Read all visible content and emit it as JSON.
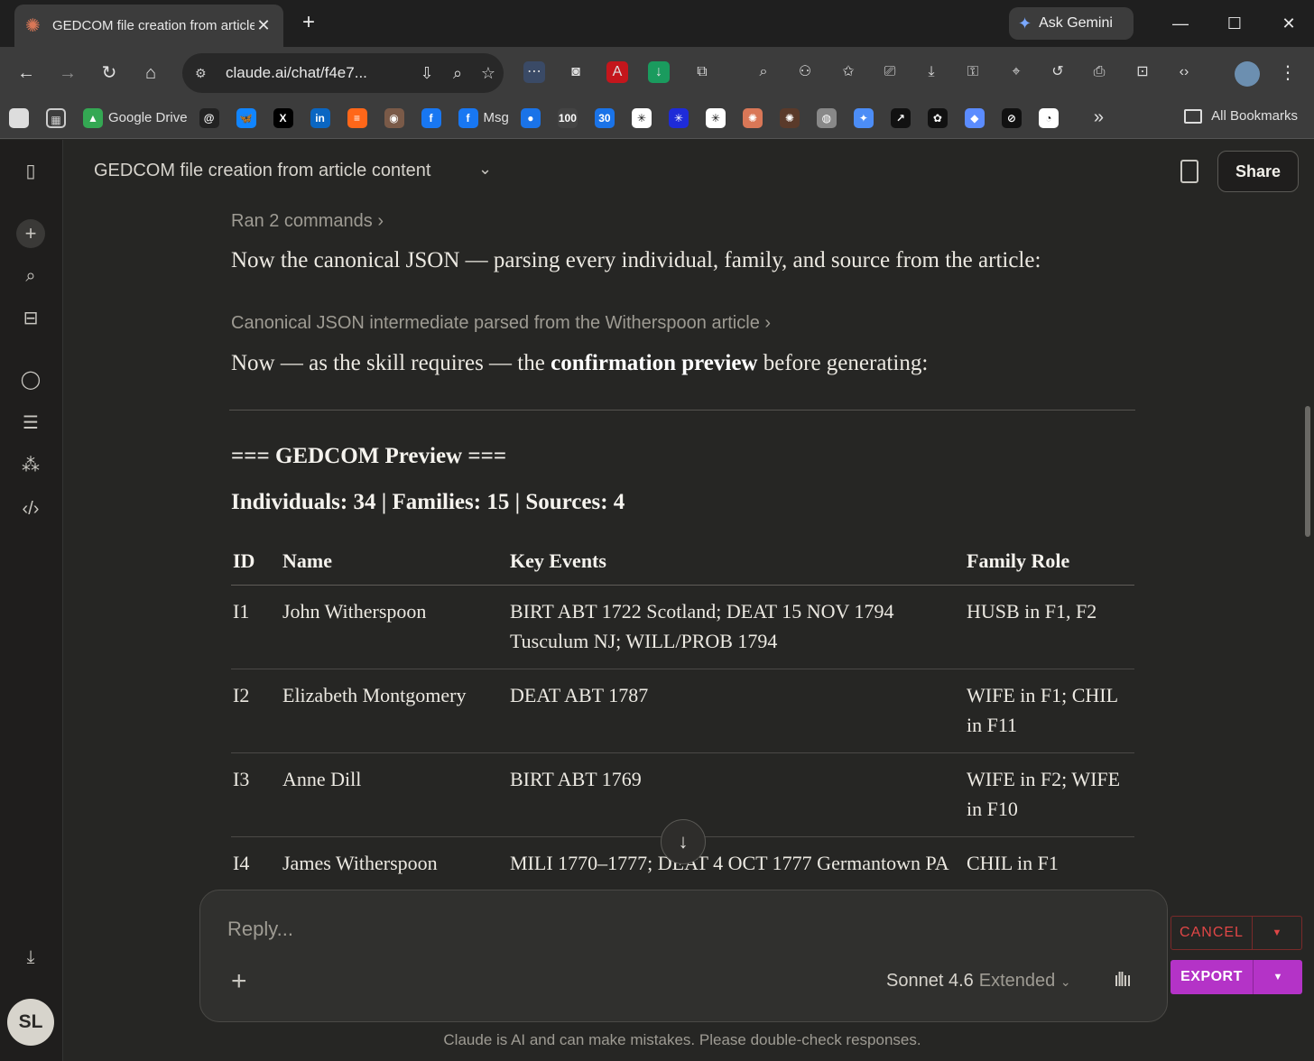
{
  "browser": {
    "tab_title": "GEDCOM file creation from article content",
    "ask_gemini": "Ask Gemini",
    "url": "claude.ai/chat/f4e7...",
    "bookmarks": [
      {
        "label": "Google Drive",
        "color": "#34a853",
        "glyph": "▲"
      },
      {
        "label": "",
        "color": "#222222",
        "glyph": "@"
      },
      {
        "label": "",
        "color": "#1185fe",
        "glyph": "🦋"
      },
      {
        "label": "",
        "color": "#000000",
        "glyph": "X"
      },
      {
        "label": "",
        "color": "#0a66c2",
        "glyph": "in"
      },
      {
        "label": "",
        "color": "#ff6719",
        "glyph": "≡"
      },
      {
        "label": "",
        "color": "#7a5a48",
        "glyph": "◉"
      },
      {
        "label": "",
        "color": "#1877f2",
        "glyph": "f"
      },
      {
        "label": "Msg",
        "color": "#1877f2",
        "glyph": "f"
      },
      {
        "label": "",
        "color": "#1a73e8",
        "glyph": "●"
      },
      {
        "label": "",
        "color": "#444444",
        "glyph": "100"
      },
      {
        "label": "",
        "color": "#1a73e8",
        "glyph": "30"
      },
      {
        "label": "",
        "color": "#ffffff",
        "glyph": "✳"
      },
      {
        "label": "",
        "color": "#1e2bd8",
        "glyph": "✳"
      },
      {
        "label": "",
        "color": "#ffffff",
        "glyph": "✳"
      },
      {
        "label": "",
        "color": "#d97757",
        "glyph": "✺"
      },
      {
        "label": "",
        "color": "#5a3a2a",
        "glyph": "✺"
      },
      {
        "label": "",
        "color": "#888888",
        "glyph": "◍"
      },
      {
        "label": "",
        "color": "#4c8df6",
        "glyph": "✦"
      },
      {
        "label": "",
        "color": "#111111",
        "glyph": "↗"
      },
      {
        "label": "",
        "color": "#111111",
        "glyph": "✿"
      },
      {
        "label": "",
        "color": "#5b8cff",
        "glyph": "◆"
      },
      {
        "label": "",
        "color": "#111111",
        "glyph": "⊘"
      },
      {
        "label": "",
        "color": "#ffffff",
        "glyph": "◔"
      }
    ],
    "all_bookmarks": "All Bookmarks"
  },
  "app": {
    "chat_title": "GEDCOM file creation from article content",
    "share_label": "Share",
    "user_initials": "SL"
  },
  "message": {
    "ran_commands": "Ran 2 commands",
    "line1": "Now the canonical JSON — parsing every individual, family, and source from the article:",
    "artifact_label": "Canonical JSON intermediate parsed from the Witherspoon article",
    "line2_pre": "Now — as the skill requires — the ",
    "line2_bold": "confirmation preview",
    "line2_post": " before generating:",
    "preview_heading": "=== GEDCOM Preview ===",
    "preview_summary": "Individuals: 34 | Families: 15 | Sources: 4"
  },
  "table": {
    "headers": [
      "ID",
      "Name",
      "Key Events",
      "Family Role"
    ],
    "rows": [
      [
        "I1",
        "John Witherspoon",
        "BIRT ABT 1722 Scotland; DEAT 15 NOV 1794 Tusculum NJ; WILL/PROB 1794",
        "HUSB in F1, F2"
      ],
      [
        "I2",
        "Elizabeth Montgomery",
        "DEAT ABT 1787",
        "WIFE in F1; CHIL in F11"
      ],
      [
        "I3",
        "Anne Dill",
        "BIRT ABT 1769",
        "WIFE in F2; WIFE in F10"
      ],
      [
        "I4",
        "James Witherspoon",
        "MILI 1770–1777; DEAT 4 OCT 1777 Germantown PA",
        "CHIL in F1"
      ]
    ]
  },
  "composer": {
    "placeholder": "Reply...",
    "model": "Sonnet 4.6",
    "mode": "Extended"
  },
  "disclaimer": "Claude is AI and can make mistakes. Please double-check responses.",
  "overlay": {
    "cancel_label": "CANCEL",
    "export_label": "EXPORT"
  },
  "colors": {
    "background": "#262624",
    "sidebar": "#1f1e1d",
    "export": "#b433c7",
    "cancel": "#e04646"
  }
}
